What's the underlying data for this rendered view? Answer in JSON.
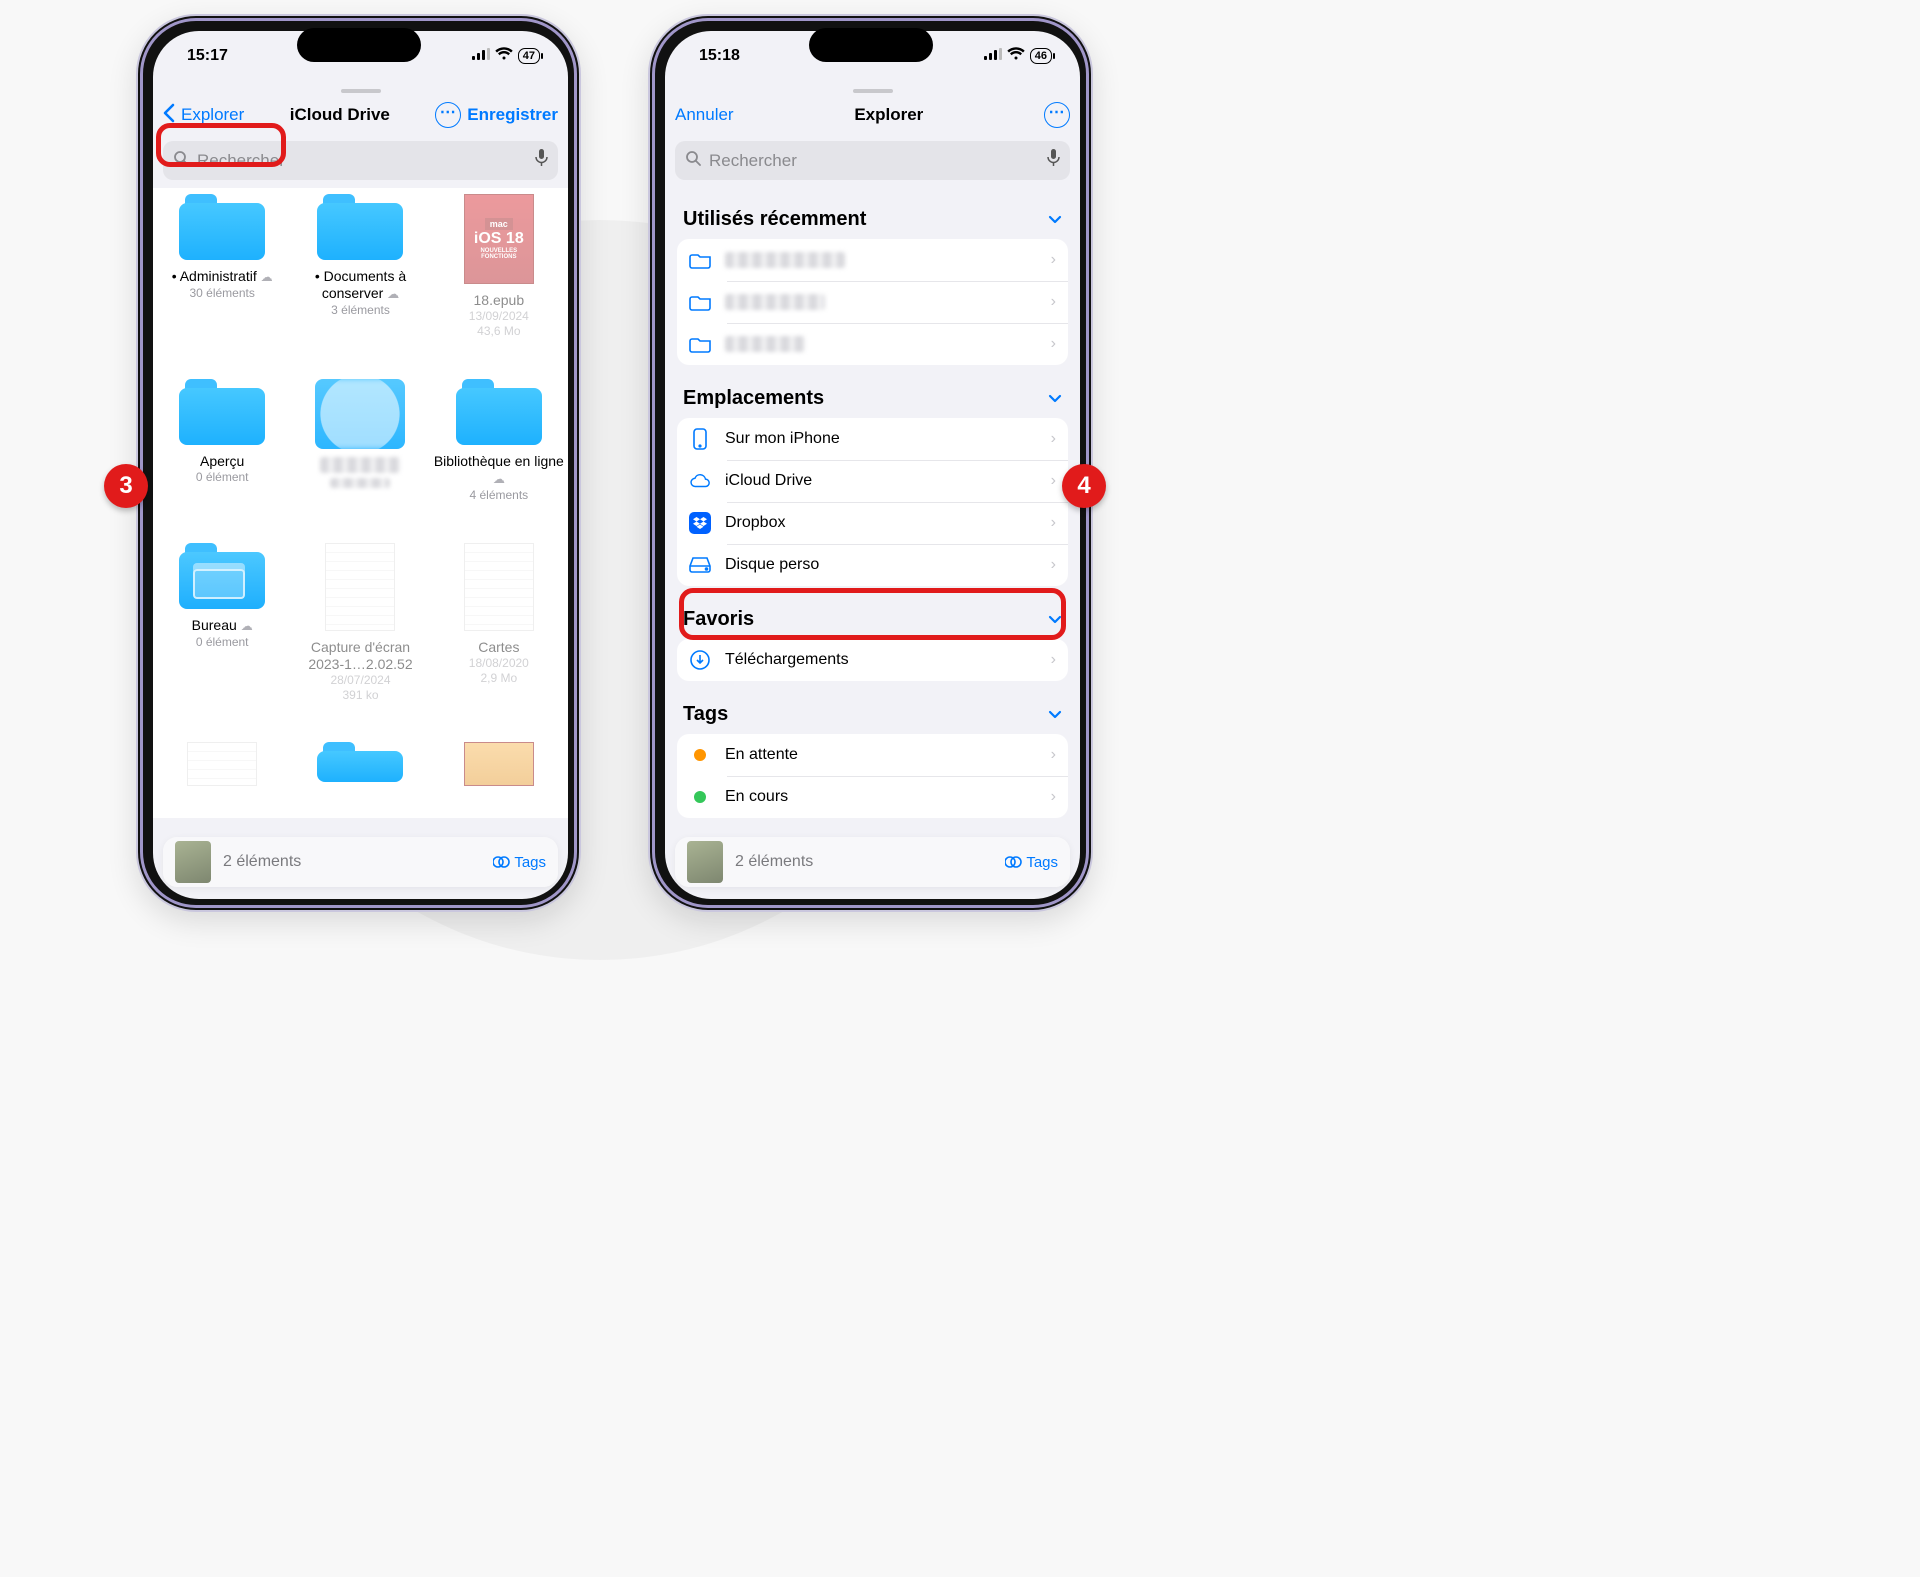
{
  "callouts": {
    "left": "3",
    "right": "4"
  },
  "left": {
    "status": {
      "time": "15:17",
      "battery": "47"
    },
    "nav": {
      "back": "Explorer",
      "title": "iCloud Drive",
      "save": "Enregistrer"
    },
    "search": {
      "placeholder": "Rechercher"
    },
    "items": [
      {
        "name": "• Administratif",
        "meta": "30 éléments",
        "clouded": true
      },
      {
        "name": "• Documents à conserver",
        "meta": "3 éléments",
        "clouded": true
      },
      {
        "name": "18.epub",
        "meta1": "13/09/2024",
        "meta2": "43,6 Mo",
        "epub": "iOS 18",
        "epub_sub": "NOUVELLES FONCTIONS",
        "dim": true
      },
      {
        "name": "Aperçu",
        "meta": "0 élément"
      },
      {
        "name": "",
        "meta": "",
        "pixelated": true
      },
      {
        "name": "Bibliothèque en ligne",
        "meta": "4 éléments",
        "clouded": true
      },
      {
        "name": "Bureau",
        "meta": "0 élément",
        "clouded": true
      },
      {
        "name": "Capture d'écran 2023-1…2.02.52",
        "meta1": "28/07/2024",
        "meta2": "391 ko",
        "dim": true,
        "page": true
      },
      {
        "name": "Cartes",
        "meta1": "18/08/2020",
        "meta2": "2,9 Mo",
        "dim": true,
        "page": true
      }
    ],
    "toolbar": {
      "count": "2 éléments",
      "tags": "Tags"
    }
  },
  "right": {
    "status": {
      "time": "15:18",
      "battery": "46"
    },
    "nav": {
      "cancel": "Annuler",
      "title": "Explorer"
    },
    "search": {
      "placeholder": "Rechercher"
    },
    "sections": {
      "recent": {
        "title": "Utilisés récemment"
      },
      "locations": {
        "title": "Emplacements",
        "items": [
          {
            "label": "Sur mon iPhone",
            "icon": "iphone"
          },
          {
            "label": "iCloud Drive",
            "icon": "cloud"
          },
          {
            "label": "Dropbox",
            "icon": "dropbox"
          },
          {
            "label": "Disque perso",
            "icon": "drive",
            "highlight": true
          }
        ]
      },
      "favoris": {
        "title": "Favoris",
        "items": [
          {
            "label": "Téléchargements",
            "icon": "download"
          }
        ]
      },
      "tags": {
        "title": "Tags",
        "items": [
          {
            "label": "En attente",
            "color": "#ff9500"
          },
          {
            "label": "En cours",
            "color": "#34c759"
          }
        ]
      }
    },
    "toolbar": {
      "count": "2 éléments",
      "tags": "Tags"
    }
  }
}
